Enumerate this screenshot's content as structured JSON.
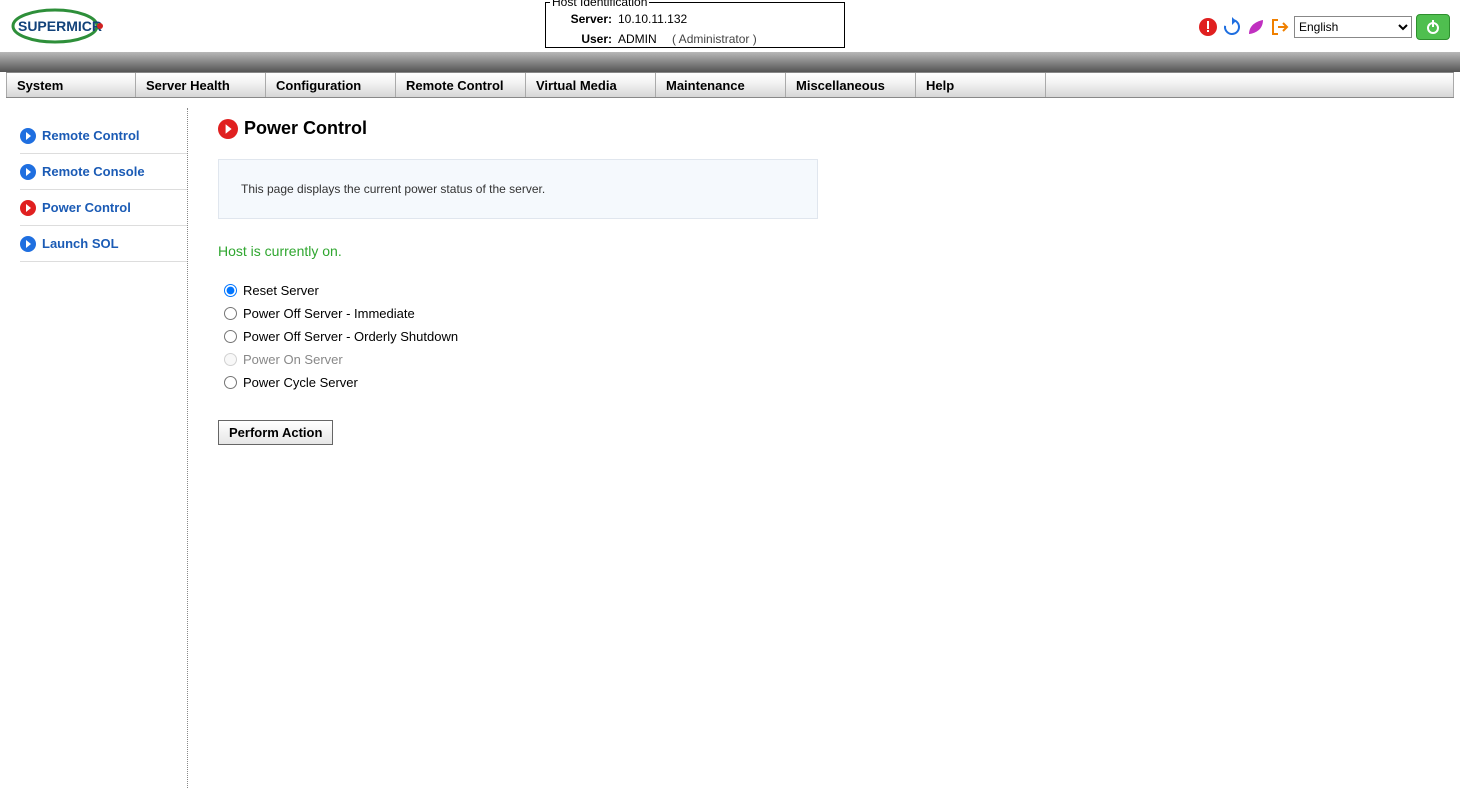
{
  "header": {
    "host_identification_legend": "Host Identification",
    "server_label": "Server:",
    "server_value": "10.10.11.132",
    "user_label": "User:",
    "user_value": "ADMIN",
    "user_role": "( Administrator )",
    "language_selected": "English",
    "power_icon": "⏻"
  },
  "nav": {
    "tabs": [
      "System",
      "Server Health",
      "Configuration",
      "Remote Control",
      "Virtual Media",
      "Maintenance",
      "Miscellaneous",
      "Help"
    ]
  },
  "sidebar": {
    "items": [
      {
        "label": "Remote Control",
        "active": false
      },
      {
        "label": "Remote Console",
        "active": false
      },
      {
        "label": "Power Control",
        "active": true
      },
      {
        "label": "Launch SOL",
        "active": false
      }
    ]
  },
  "main": {
    "title": "Power Control",
    "description": "This page displays the current power status of the server.",
    "status": "Host is currently on.",
    "options": [
      {
        "label": "Reset Server",
        "checked": true,
        "disabled": false
      },
      {
        "label": "Power Off Server - Immediate",
        "checked": false,
        "disabled": false
      },
      {
        "label": "Power Off Server - Orderly Shutdown",
        "checked": false,
        "disabled": false
      },
      {
        "label": "Power On Server",
        "checked": false,
        "disabled": true
      },
      {
        "label": "Power Cycle Server",
        "checked": false,
        "disabled": false
      }
    ],
    "action_button": "Perform Action"
  }
}
